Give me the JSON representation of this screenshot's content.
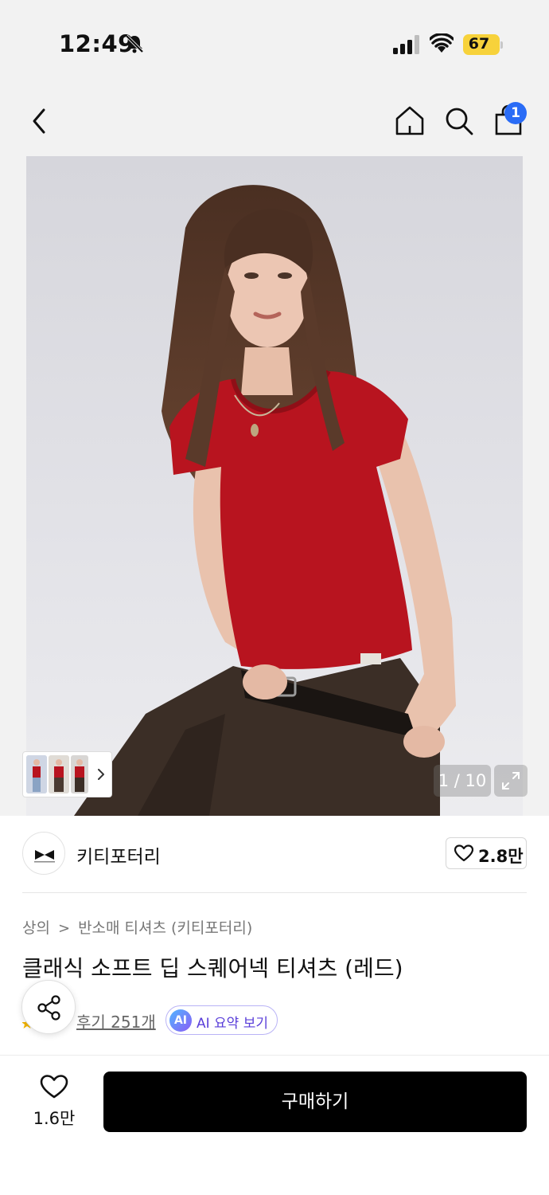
{
  "status_bar": {
    "time": "12:49",
    "battery": "67",
    "icons": [
      "bell-slash-icon",
      "signal-icon",
      "wifi-icon",
      "battery-icon"
    ]
  },
  "nav": {
    "icons": [
      "back-chevron-icon",
      "home-icon",
      "search-icon",
      "shopping-bag-icon"
    ],
    "cart_badge": "1"
  },
  "gallery": {
    "page_counter": "1 / 10",
    "expand_icon": "expand-icon",
    "thumb_arrow_icon": "chevron-right-icon"
  },
  "brand": {
    "name": "키티포터리",
    "like_count": "2.8만",
    "logo_icon": "brand-logo-icon"
  },
  "product": {
    "breadcrumb": [
      "상의",
      "반소매 티셔츠 (키티포터리)"
    ],
    "breadcrumb_separator": ">",
    "title": "클래식 소프트 딥 스퀘어넥 티셔츠 (레드)",
    "review_label": "후기 251개",
    "ai_badge": "AI",
    "ai_label": "AI 요약 보기"
  },
  "bottom_bar": {
    "wish_count": "1.6만",
    "buy_label": "구매하기"
  },
  "colors": {
    "background": "#f2f2f2",
    "buy_button": "#000000",
    "cart_badge": "#2a6cf6",
    "battery": "#f7d23b",
    "ai_accent": "#5a3fd9",
    "shirt_red": "#b8141f"
  }
}
